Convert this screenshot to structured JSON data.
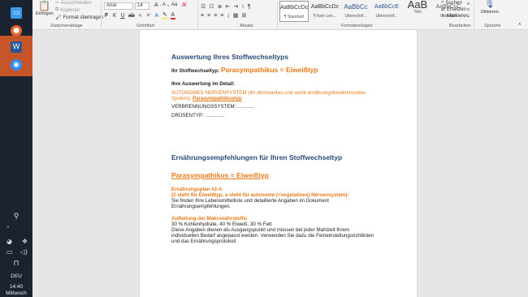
{
  "taskbar": {
    "lang": "DEU",
    "time": "14:40",
    "day": "Mittwoch"
  },
  "ribbon": {
    "paste_label": "Einfügen",
    "cut_label": "Ausschneiden",
    "copy_label": "Kopieren",
    "format_painter_label": "Format übertragen",
    "clipboard_group": "Zwischenablage",
    "font_name": "Arial",
    "font_size": "14",
    "font_group": "Schriftart",
    "paragraph_group": "Absatz",
    "styles_group": "Formatvorlagen",
    "edit_group": "Bearbeiten",
    "speech_group": "Sprache",
    "search_label": "Suchen",
    "replace_label": "Ersetzen",
    "select_label": "Markieren",
    "dictate_label": "Diktieren",
    "styles": [
      {
        "preview": "AaBbCcDc",
        "name": "¶ Standard"
      },
      {
        "preview": "AaBbCcDc",
        "name": "¶ Kein Lee..."
      },
      {
        "preview": "AaBbCc",
        "name": "Überschrif..."
      },
      {
        "preview": "AaBbCcE",
        "name": "Überschrif..."
      },
      {
        "preview": "AaB",
        "name": "Titel"
      },
      {
        "preview": "AaBbCcC",
        "name": "Untertitel"
      }
    ]
  },
  "document": {
    "heading1": "Auswertung Ihres Stoffwechseltyps",
    "type_label": "Ihr Stoffwechseltyp:",
    "type_value": "Parasympathikus = Eiweißtyp",
    "detail_label": "Ihre Auswertung im Detail:",
    "ans_line1": "AUTONOMES NERVENSYSTEM (Ihr dominantes und somit ernährungsbestimmendes",
    "ans_line2": "System):",
    "ans_value": "Parasympathikustyp",
    "burn_label": "VERBRENNUNGSSYSTEM: ............",
    "gland_label": "DRÜSENTYP: ..............",
    "heading2": "Ernährungsempfehlungen für Ihren Stoffwechseltyp",
    "section_title": "Parasympathikus = Eiweißtyp",
    "plan_title": "Ernährungsplan #2-A",
    "plan_sub": "(2 steht für Eiweißtyp, a steht für autonome (=vegetatives) Nervensystem):",
    "plan_text1": "Sie finden Ihre Lebensmittelliste und detaillierte Angaben im Dokument",
    "plan_text2": "Ernährungsempfehlungen.",
    "macro_title": "Aufteilung der Makronährstoffe:",
    "macro_values": "30 % Kohlenhydrate, 40 % Eiweiß, 30 % Fett",
    "macro_text1": "Diese Angaben dienen als Ausgangspunkt und müssen bei jeder Mahlzeit Ihrem",
    "macro_text2": "individuellen Bedarf angepasst werden. Verwenden Sie dazu die Feineinstellungsrichtlinien",
    "macro_text3": "und das Ernährungsprotokoll."
  },
  "colors": {
    "accent_orange": "#e77817",
    "heading_blue": "#2a4a7a",
    "taskbar": "#1b2330",
    "taskbar_active": "#c6562a"
  }
}
